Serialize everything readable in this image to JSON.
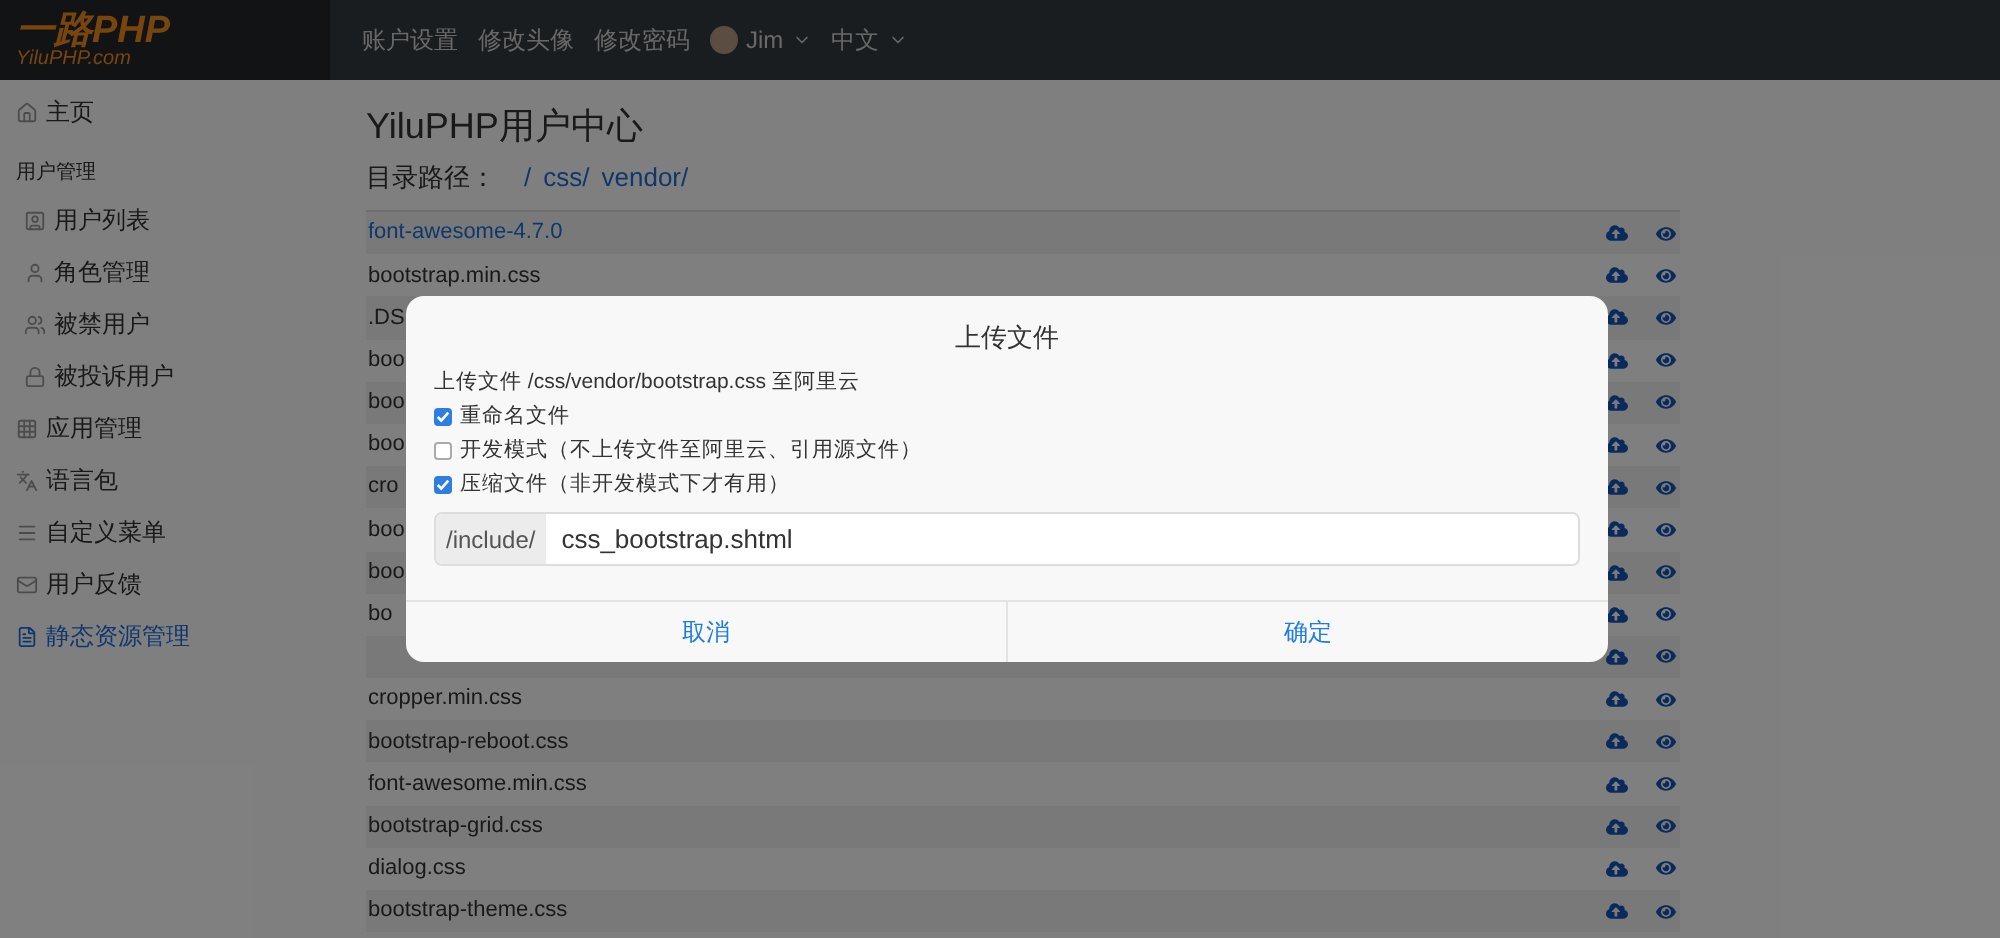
{
  "header": {
    "logo": {
      "title": "一路PHP",
      "subtitle": "YiluPHP.com"
    },
    "nav": [
      {
        "label": "账户设置",
        "kind": "link"
      },
      {
        "label": "修改头像",
        "kind": "link"
      },
      {
        "label": "修改密码",
        "kind": "link"
      },
      {
        "label": "Jim",
        "kind": "user"
      },
      {
        "label": "中文",
        "kind": "dropdown"
      }
    ]
  },
  "sidebar": {
    "items": [
      {
        "label": "主页",
        "kind": "item",
        "selected": false
      },
      {
        "label": "用户管理",
        "kind": "group"
      },
      {
        "label": "用户列表",
        "kind": "subitem",
        "selected": false
      },
      {
        "label": "角色管理",
        "kind": "subitem",
        "selected": false
      },
      {
        "label": "被禁用户",
        "kind": "subitem",
        "selected": false
      },
      {
        "label": "被投诉用户",
        "kind": "subitem",
        "selected": false
      },
      {
        "label": "应用管理",
        "kind": "item",
        "selected": false
      },
      {
        "label": "语言包",
        "kind": "item",
        "selected": false
      },
      {
        "label": "自定义菜单",
        "kind": "item",
        "selected": false
      },
      {
        "label": "用户反馈",
        "kind": "item",
        "selected": false
      },
      {
        "label": "静态资源管理",
        "kind": "item",
        "selected": true
      }
    ]
  },
  "page": {
    "title": "YiluPHP用户中心",
    "path_label": "目录路径：",
    "path": [
      "/",
      "css/",
      "vendor/"
    ]
  },
  "files": [
    {
      "name": "font-awesome-4.7.0",
      "kind": "folder"
    },
    {
      "name": "bootstrap.min.css",
      "kind": "file"
    },
    {
      "name": ".DS",
      "kind": "file"
    },
    {
      "name": "boo",
      "kind": "file"
    },
    {
      "name": "boo",
      "kind": "file"
    },
    {
      "name": "boo",
      "kind": "file"
    },
    {
      "name": "cro",
      "kind": "file"
    },
    {
      "name": "boo",
      "kind": "file"
    },
    {
      "name": "boo",
      "kind": "file"
    },
    {
      "name": "bo",
      "kind": "file"
    },
    {
      "kind": "covered"
    },
    {
      "name": "cropper.min.css",
      "kind": "file"
    },
    {
      "name": "bootstrap-reboot.css",
      "kind": "file"
    },
    {
      "name": "font-awesome.min.css",
      "kind": "file"
    },
    {
      "name": "bootstrap-grid.css",
      "kind": "file"
    },
    {
      "name": "dialog.css",
      "kind": "file"
    },
    {
      "name": "bootstrap-theme.css",
      "kind": "file"
    }
  ],
  "dialog": {
    "title": "上传文件",
    "description": "上传文件 /css/vendor/bootstrap.css 至阿里云",
    "options": [
      {
        "label": "重命名文件",
        "checked": true
      },
      {
        "label": "开发模式（不上传文件至阿里云、引用源文件）",
        "checked": false
      },
      {
        "label": "压缩文件（非开发模式下才有用）",
        "checked": true
      }
    ],
    "prefix": "/include/",
    "value": "css_bootstrap.shtml",
    "buttons": [
      "取消",
      "确定"
    ]
  }
}
